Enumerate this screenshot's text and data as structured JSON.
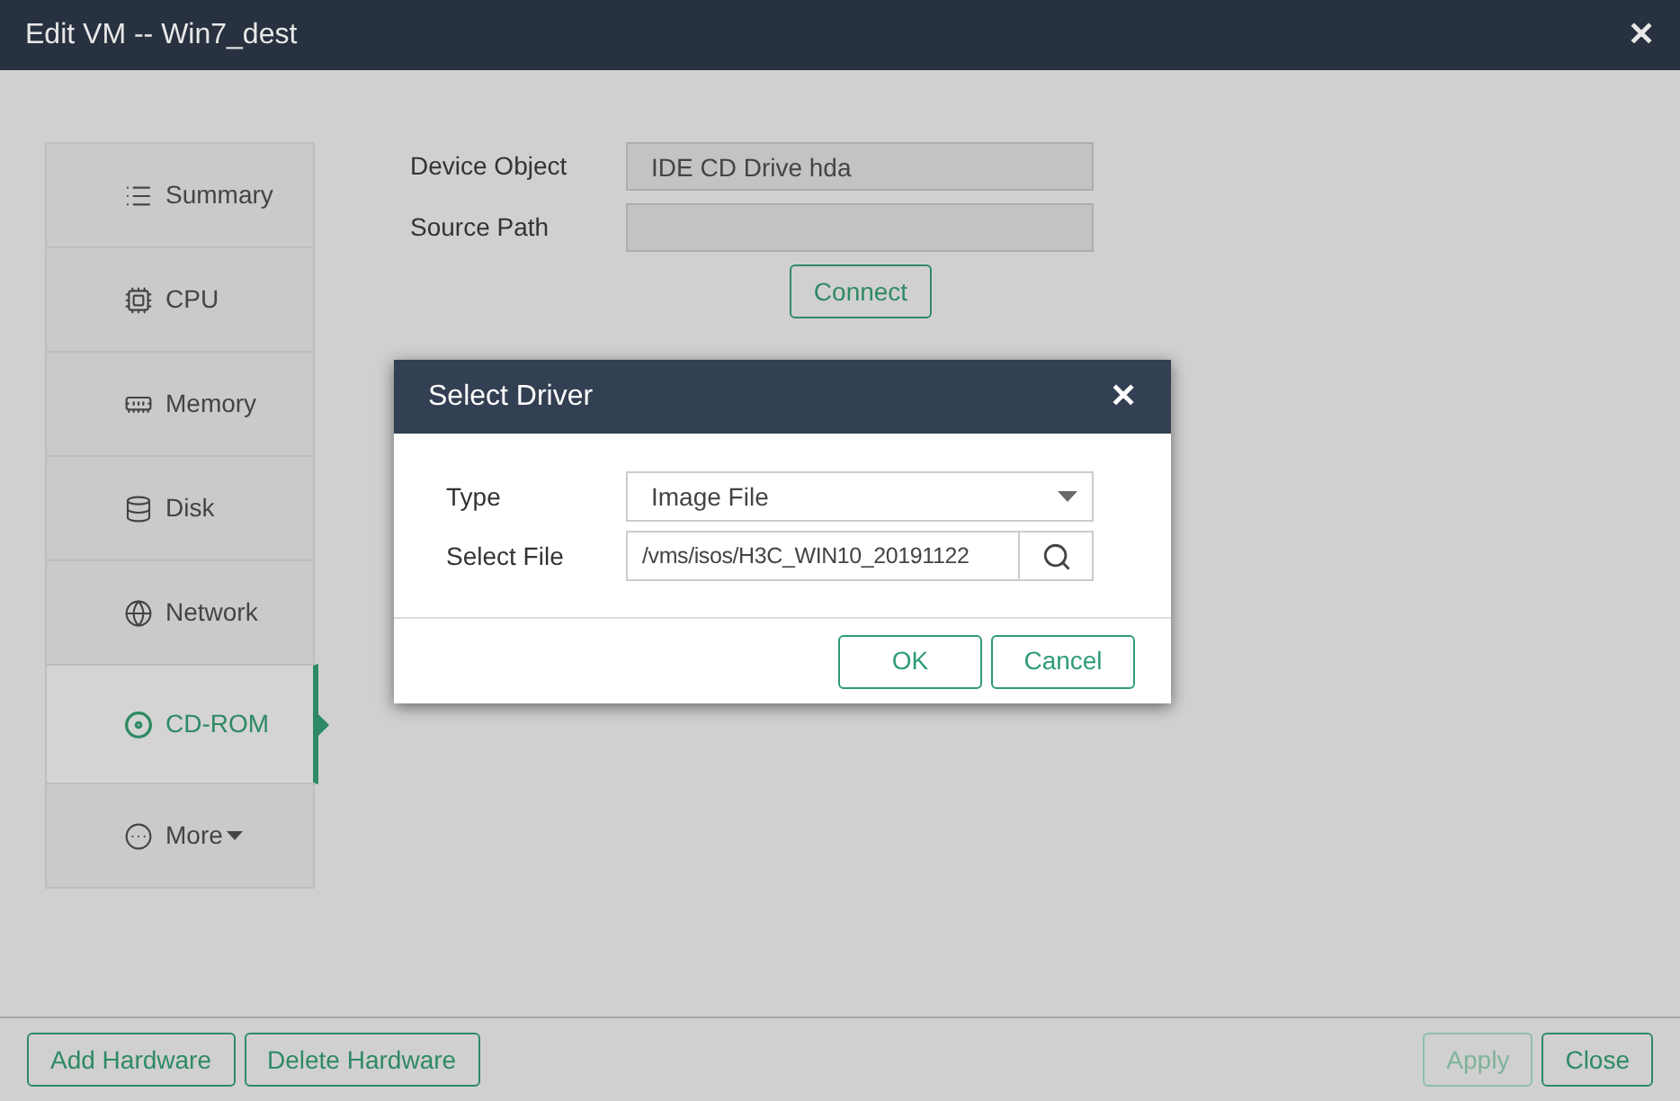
{
  "window": {
    "title": "Edit VM -- Win7_dest",
    "close": "✕"
  },
  "sidebar": {
    "items": [
      {
        "label": "Summary",
        "selected": false,
        "menu": false
      },
      {
        "label": "CPU",
        "selected": false,
        "menu": false
      },
      {
        "label": "Memory",
        "selected": false,
        "menu": false
      },
      {
        "label": "Disk",
        "selected": false,
        "menu": false
      },
      {
        "label": "Network",
        "selected": false,
        "menu": false
      },
      {
        "label": "CD-ROM",
        "selected": true,
        "menu": false
      },
      {
        "label": "More",
        "selected": false,
        "menu": true
      }
    ]
  },
  "form": {
    "fields": [
      {
        "label": "Device Object",
        "value": "IDE CD Drive hda"
      },
      {
        "label": "Source Path"
      }
    ],
    "connect_button": "Connect"
  },
  "dialog": {
    "title": "Select Driver",
    "close": "✕",
    "type": {
      "label": "Type",
      "value": "Image File"
    },
    "file": {
      "label": "Select File",
      "value": "/vms/isos/H3C_WIN10_20191122"
    },
    "buttons": [
      "OK",
      "Cancel"
    ]
  },
  "footer": {
    "left_buttons": [
      {
        "label": "Add Hardware",
        "disabled": false
      },
      {
        "label": "Delete Hardware",
        "disabled": false
      }
    ],
    "right_buttons": [
      {
        "label": "Apply",
        "disabled": true
      },
      {
        "label": "Close",
        "disabled": false
      }
    ]
  }
}
